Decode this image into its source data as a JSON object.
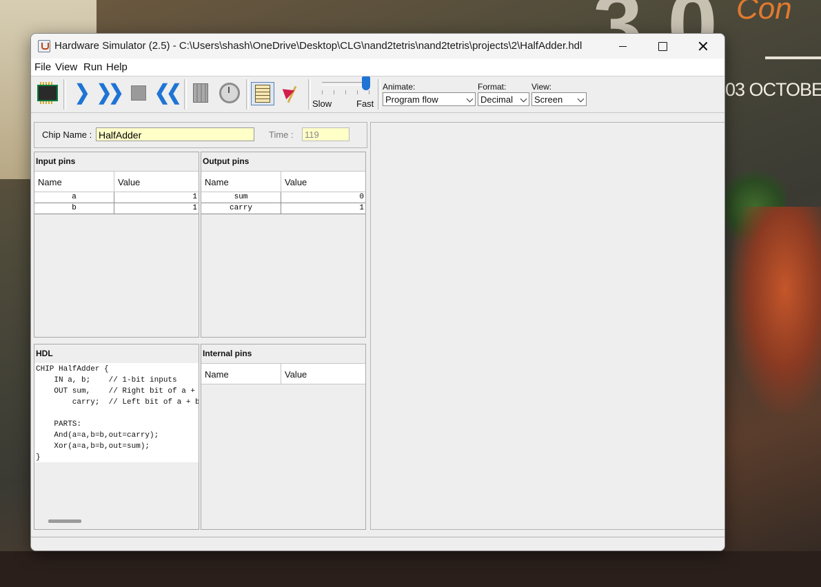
{
  "desktop": {
    "big_text": "3.0",
    "script_text": "Con",
    "date_text": "03 OCTOBE"
  },
  "window": {
    "title": "Hardware Simulator (2.5) - C:\\Users\\shash\\OneDrive\\Desktop\\CLG\\nand2tetris\\nand2tetris\\projects\\2\\HalfAdder.hdl"
  },
  "menu": {
    "file": "File",
    "view": "View",
    "run": "Run",
    "help": "Help"
  },
  "toolbar": {
    "speed_slow": "Slow",
    "speed_fast": "Fast",
    "speed_level": 1.0,
    "animate_label": "Animate:",
    "animate_value": "Program flow",
    "format_label": "Format:",
    "format_value": "Decimal",
    "view_label": "View:",
    "view_value": "Screen"
  },
  "chip": {
    "name_label": "Chip Name :",
    "name_value": "HalfAdder",
    "time_label": "Time :",
    "time_value": "119"
  },
  "input_pins": {
    "title": "Input pins",
    "col_name": "Name",
    "col_value": "Value",
    "rows": [
      {
        "name": "a",
        "value": "1"
      },
      {
        "name": "b",
        "value": "1"
      }
    ]
  },
  "output_pins": {
    "title": "Output pins",
    "col_name": "Name",
    "col_value": "Value",
    "rows": [
      {
        "name": "sum",
        "value": "0"
      },
      {
        "name": "carry",
        "value": "1"
      }
    ]
  },
  "hdl": {
    "title": "HDL",
    "code": "CHIP HalfAdder {\n    IN a, b;    // 1-bit inputs\n    OUT sum,    // Right bit of a + b\n        carry;  // Left bit of a + b\n\n    PARTS:\n    And(a=a,b=b,out=carry);\n    Xor(a=a,b=b,out=sum);\n}"
  },
  "internal_pins": {
    "title": "Internal pins",
    "col_name": "Name",
    "col_value": "Value"
  },
  "icons": {
    "load_chip": "chip-icon",
    "single_step": "single-step-icon",
    "run": "fast-forward-icon",
    "stop": "stop-icon",
    "reset": "rewind-icon",
    "eval": "calculator-icon",
    "clock": "clock-icon",
    "script": "script-icon",
    "breakpoints": "flag-icon"
  },
  "colors": {
    "accent": "#1f74d4",
    "field_bg": "#ffffc8"
  }
}
